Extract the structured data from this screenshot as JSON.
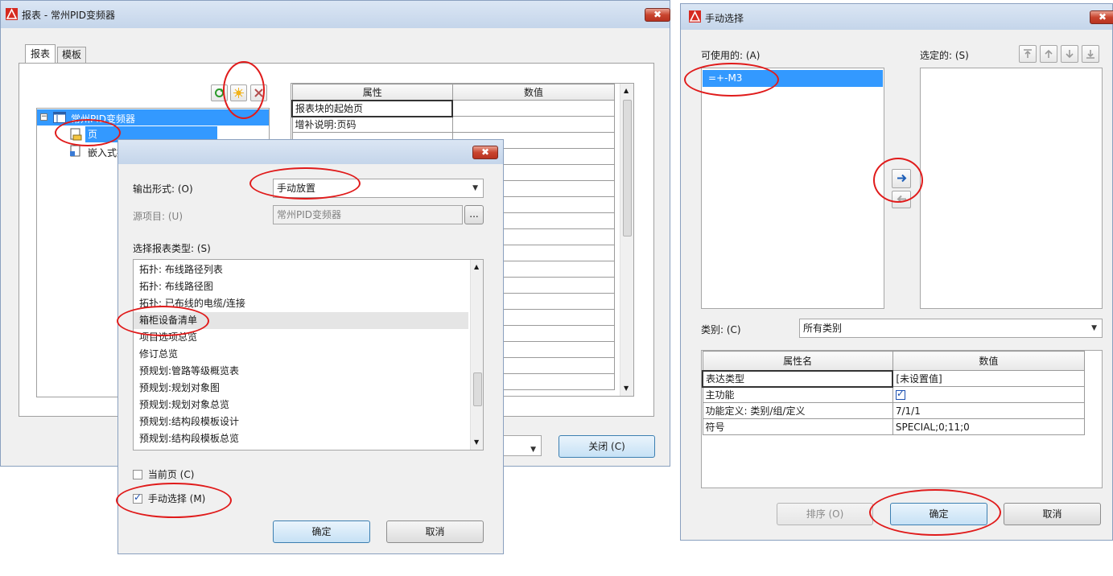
{
  "report_window": {
    "title": "报表 - 常州PID变频器",
    "close_glyph": "✖",
    "tabs": [
      "报表",
      "模板"
    ],
    "tree": {
      "root_label": "常州PID变频器",
      "node_page": "页",
      "node_embedded": "嵌入式报表"
    },
    "prop_grid": {
      "headers": [
        "属性",
        "数值"
      ],
      "rows": [
        [
          "报表块的起始页",
          ""
        ],
        [
          "增补说明:页码",
          ""
        ],
        [
          "",
          ""
        ]
      ]
    },
    "close_button": "关闭 (C)"
  },
  "output_dialog": {
    "close_glyph": "✖",
    "output_label": "输出形式: (O)",
    "output_value": "手动放置",
    "source_label": "源项目: (U)",
    "source_value": "常州PID变频器",
    "browse_label": "...",
    "type_label": "选择报表类型: (S)",
    "types": [
      "拓扑: 布线路径列表",
      "拓扑: 布线路径图",
      "拓扑: 已布线的电缆/连接",
      "箱柜设备清单",
      "项目选项总览",
      "修订总览",
      "预规划:管路等级概览表",
      "预规划:规划对象图",
      "预规划:规划对象总览",
      "预规划:结构段模板设计",
      "预规划:结构段模板总览"
    ],
    "current_page_label": "当前页 (C)",
    "manual_select_label": "手动选择 (M)",
    "ok_button": "确定",
    "cancel_button": "取消"
  },
  "manual_window": {
    "title": "手动选择",
    "close_glyph": "✖",
    "available_label": "可使用的: (A)",
    "available_items": [
      "=+-M3"
    ],
    "selected_label": "选定的: (S)",
    "category_label": "类别: (C)",
    "category_value": "所有类别",
    "attr_grid": {
      "headers": [
        "属性名",
        "数值"
      ],
      "rows": [
        [
          "表达类型",
          "[未设置值]"
        ],
        [
          "主功能",
          ""
        ],
        [
          "功能定义: 类别/组/定义",
          "7/1/1"
        ],
        [
          "符号",
          "SPECIAL;0;11;0"
        ]
      ]
    },
    "sort_button": "排序 (O)",
    "ok_button": "确定",
    "cancel_button": "取消"
  },
  "colors": {
    "highlight": "#3399ff",
    "annotation_red": "#e01b1b",
    "dialog_bg": "#f0f0f0"
  }
}
